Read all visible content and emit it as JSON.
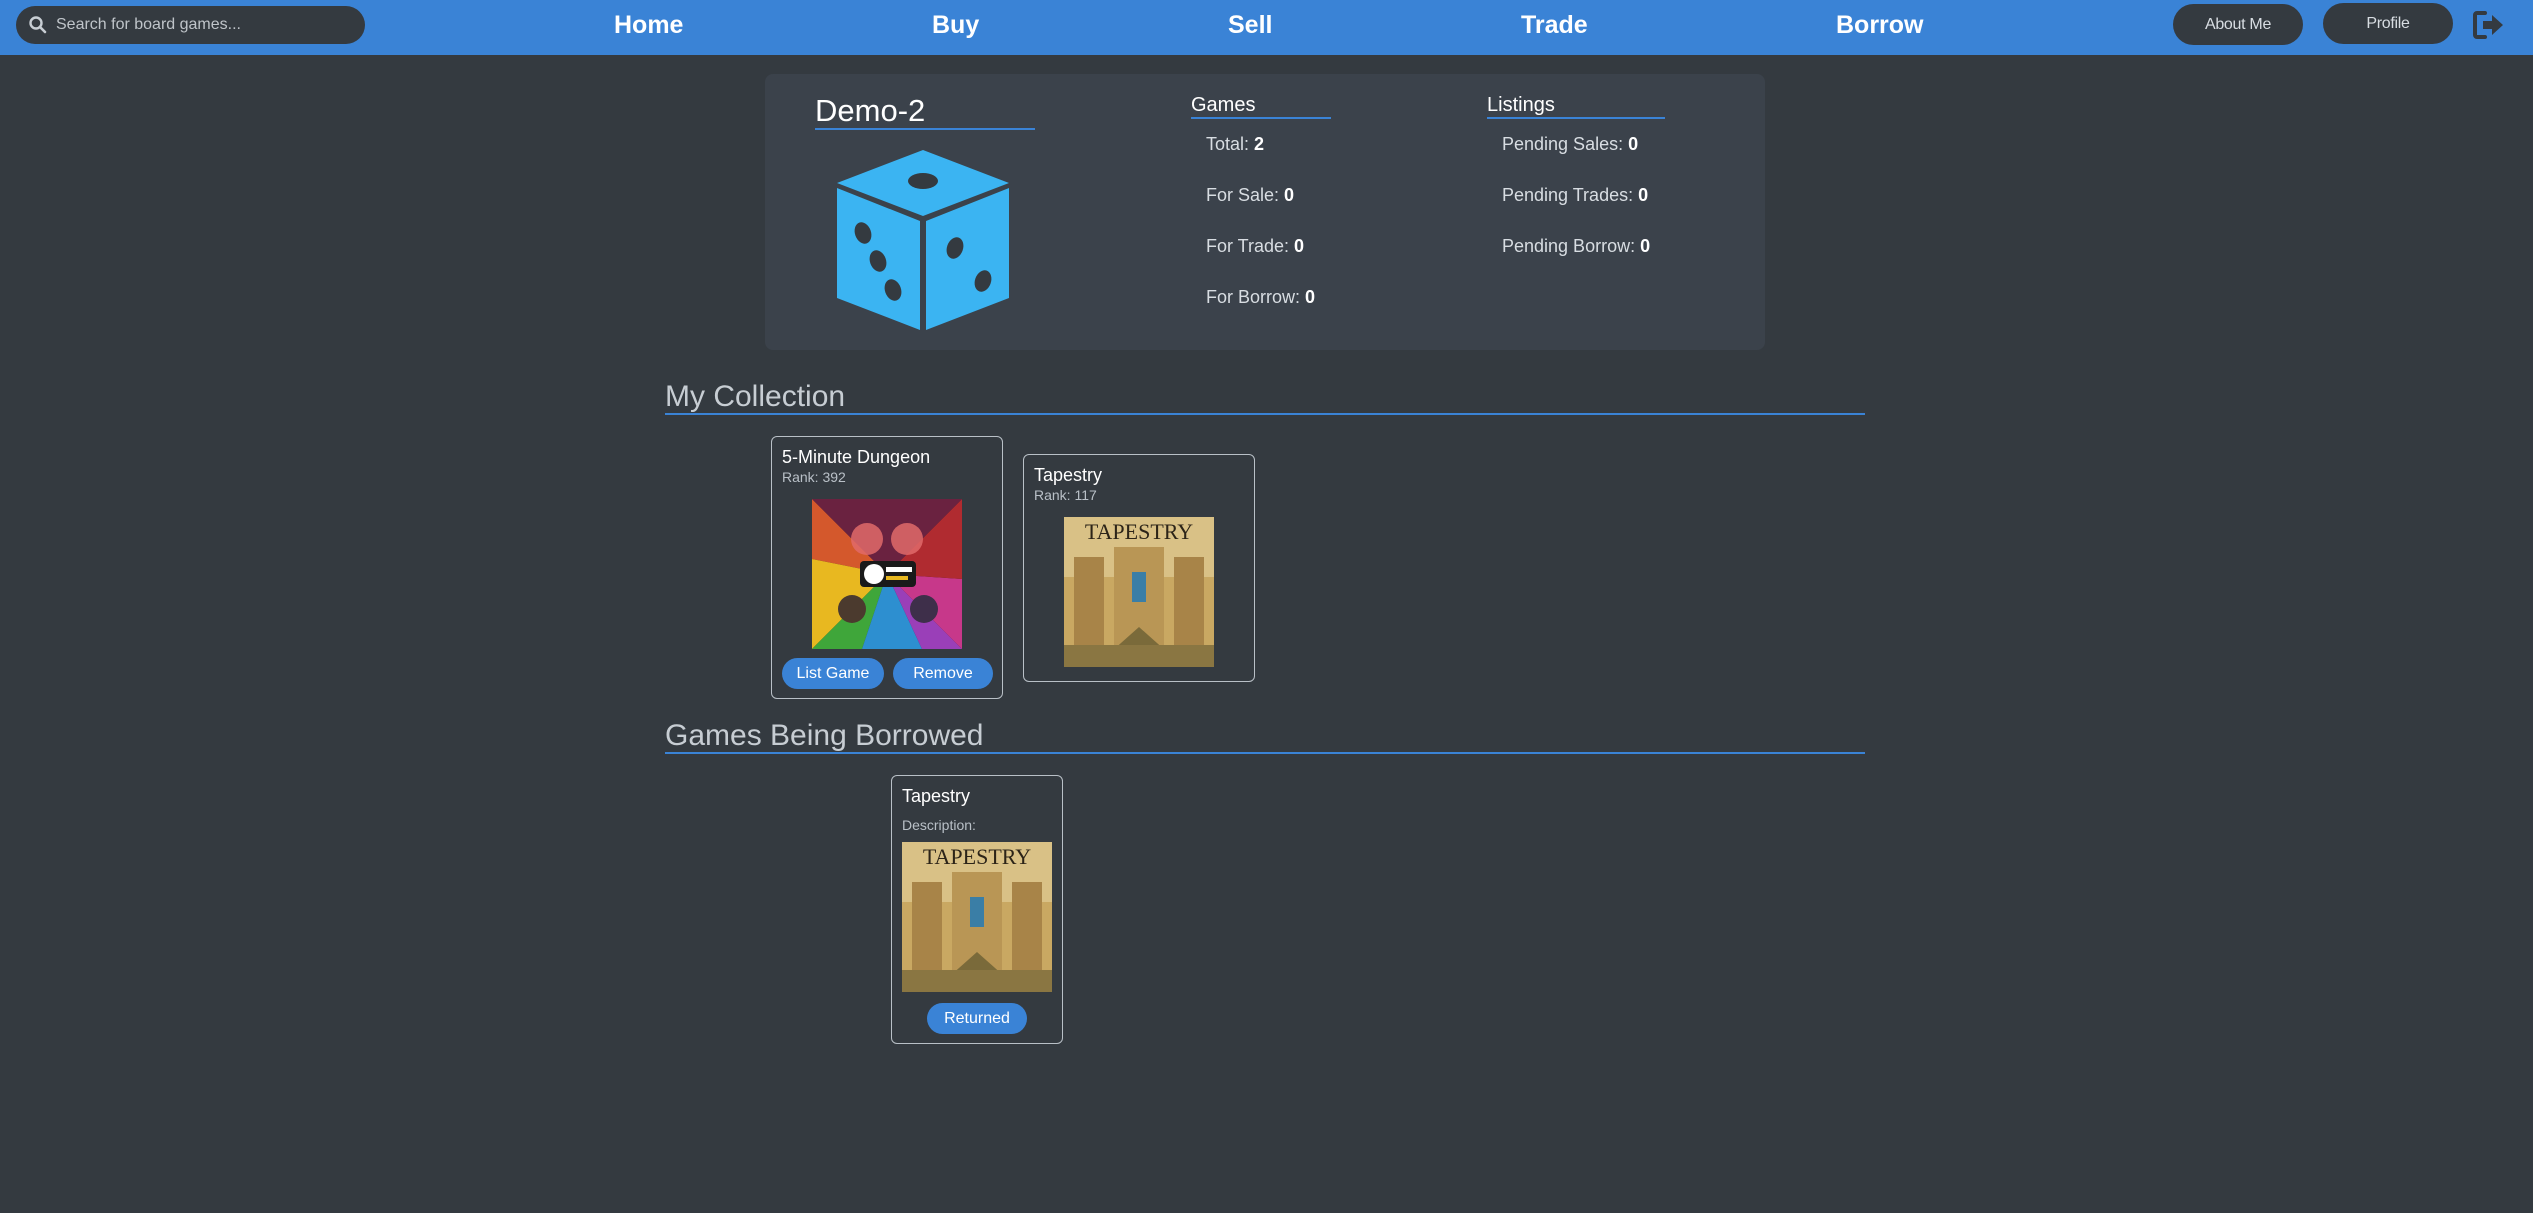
{
  "search": {
    "placeholder": "Search for board games..."
  },
  "nav": {
    "home": "Home",
    "buy": "Buy",
    "sell": "Sell",
    "trade": "Trade",
    "borrow": "Borrow",
    "about": "About Me",
    "profile": "Profile"
  },
  "user": {
    "name": "Demo-2"
  },
  "games": {
    "title": "Games",
    "total_label": "Total:",
    "total": "2",
    "for_sale_label": "For Sale:",
    "for_sale": "0",
    "for_trade_label": "For Trade:",
    "for_trade": "0",
    "for_borrow_label": "For Borrow:",
    "for_borrow": "0"
  },
  "listings": {
    "title": "Listings",
    "pending_sales_label": "Pending Sales:",
    "pending_sales": "0",
    "pending_trades_label": "Pending Trades:",
    "pending_trades": "0",
    "pending_borrow_label": "Pending Borrow:",
    "pending_borrow": "0"
  },
  "collection": {
    "title": "My Collection",
    "items": [
      {
        "name": "5-Minute Dungeon",
        "rank": "Rank: 392",
        "list_label": "List Game",
        "remove_label": "Remove"
      },
      {
        "name": "Tapestry",
        "rank": "Rank: 117"
      }
    ]
  },
  "borrowed": {
    "title": "Games Being Borrowed",
    "items": [
      {
        "name": "Tapestry",
        "description": "Description:",
        "returned_label": "Returned"
      }
    ]
  },
  "covers": {
    "tapestry_word": "TAPESTRY"
  },
  "colors": {
    "accent": "#3a83d6",
    "background": "#343a40",
    "card": "#3b424b",
    "dice": "#3bb4f2"
  }
}
